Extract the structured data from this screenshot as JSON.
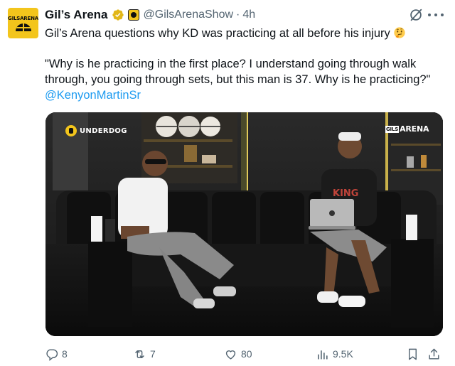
{
  "author": {
    "display_name": "Gil’s Arena",
    "handle": "@GilsArenaShow",
    "separator": "·",
    "timestamp": "4h",
    "avatar_text": "GILSARENA"
  },
  "tweet": {
    "line1": "Gil’s Arena questions why KD was practicing at all before his injury",
    "line2": "\"Why is he practicing in the first place? I understand going through walk",
    "line3": "through, you going through sets, but this man is 37. Why is he practicing?\"",
    "mention": "@KenyonMartinSr"
  },
  "media": {
    "watermark_left": "UNDERDOG",
    "watermark_right_small": "GILS",
    "watermark_right": "ARENA"
  },
  "actions": {
    "replies": "8",
    "reposts": "7",
    "likes": "80",
    "views": "9.5K"
  },
  "colors": {
    "accent": "#1d9bf0",
    "muted": "#536471",
    "brand_yellow": "#f3c51c"
  },
  "icons": [
    "verified-badge-icon",
    "affiliate-badge-icon",
    "grok-icon",
    "more-icon",
    "thinking-emoji-icon",
    "reply-icon",
    "repost-icon",
    "like-icon",
    "views-icon",
    "bookmark-icon",
    "share-icon"
  ]
}
